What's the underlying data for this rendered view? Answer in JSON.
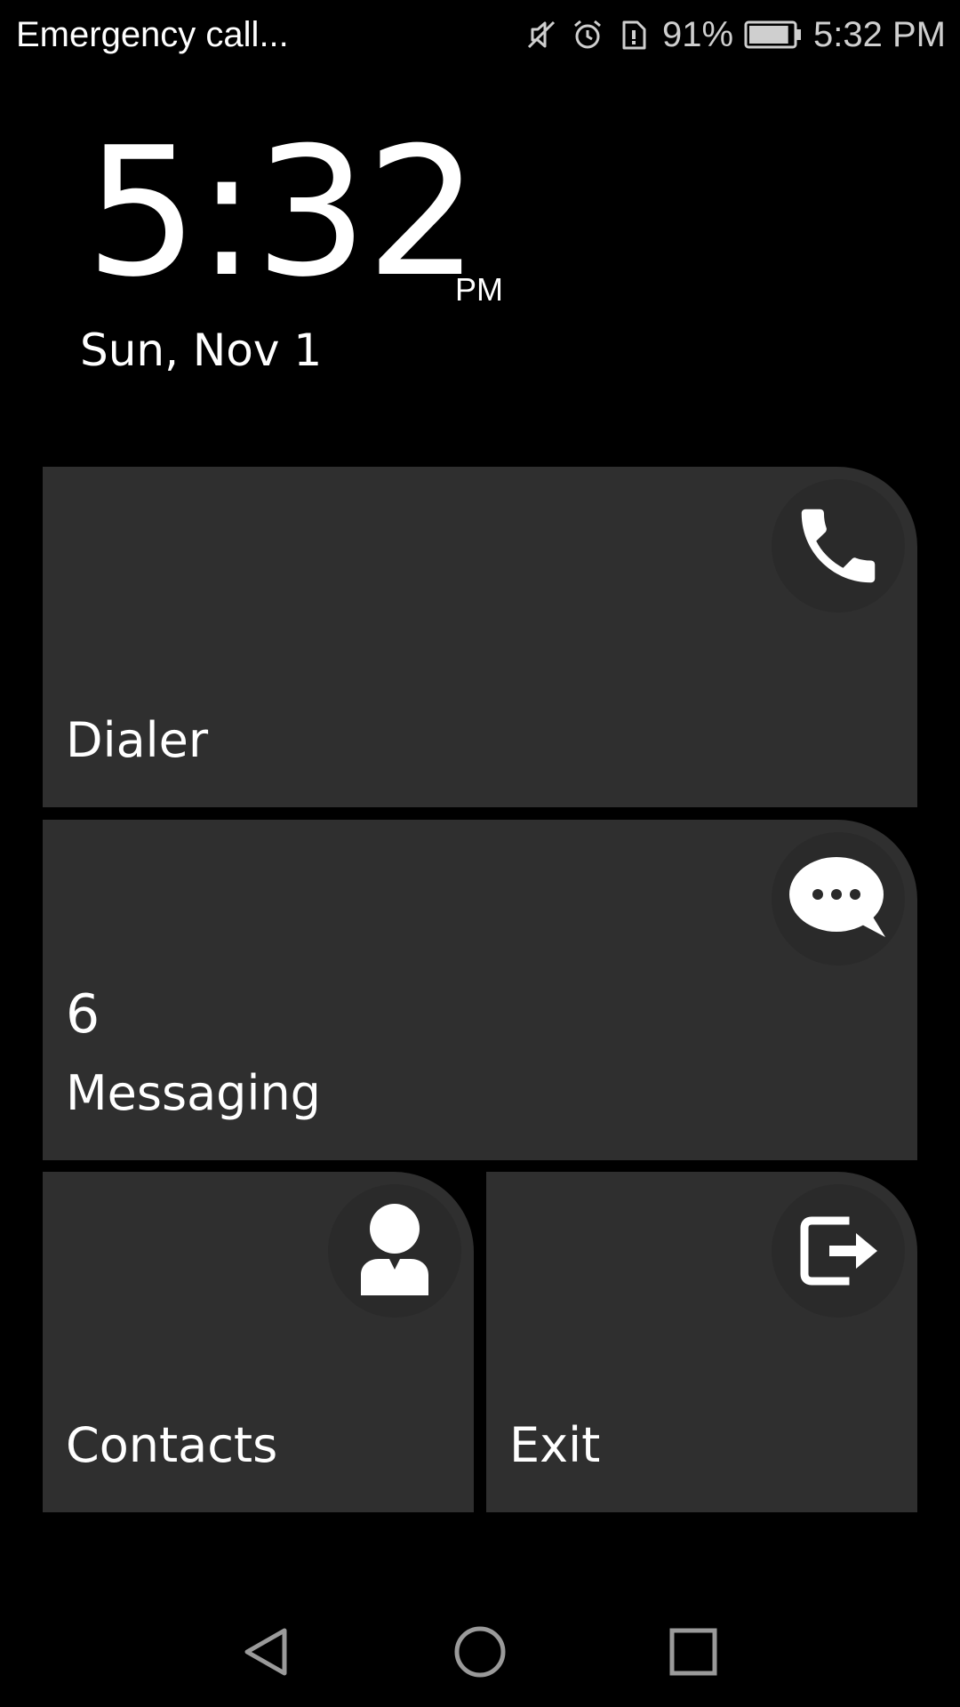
{
  "status_bar": {
    "carrier_text": "Emergency call...",
    "icons": [
      "muted-icon",
      "alarm-icon",
      "sim-card-alert-icon",
      "battery-icon"
    ],
    "battery_percent": "91%",
    "battery_level": 0.91,
    "time": "5:32 PM"
  },
  "clock": {
    "time": "5:32",
    "ampm": "PM",
    "date": "Sun, Nov 1"
  },
  "tiles": {
    "dialer": {
      "label": "Dialer",
      "icon": "phone-icon"
    },
    "messaging": {
      "label": "Messaging",
      "count": "6",
      "icon": "chat-bubble-icon"
    },
    "contacts": {
      "label": "Contacts",
      "icon": "person-icon"
    },
    "exit": {
      "label": "Exit",
      "icon": "exit-icon"
    }
  },
  "nav_bar": {
    "buttons": [
      "back-icon",
      "home-icon",
      "recents-icon"
    ]
  },
  "colors": {
    "background": "#000000",
    "tile": "#2f2f2f",
    "text": "#ffffff",
    "status_text": "#cfcfcf"
  }
}
